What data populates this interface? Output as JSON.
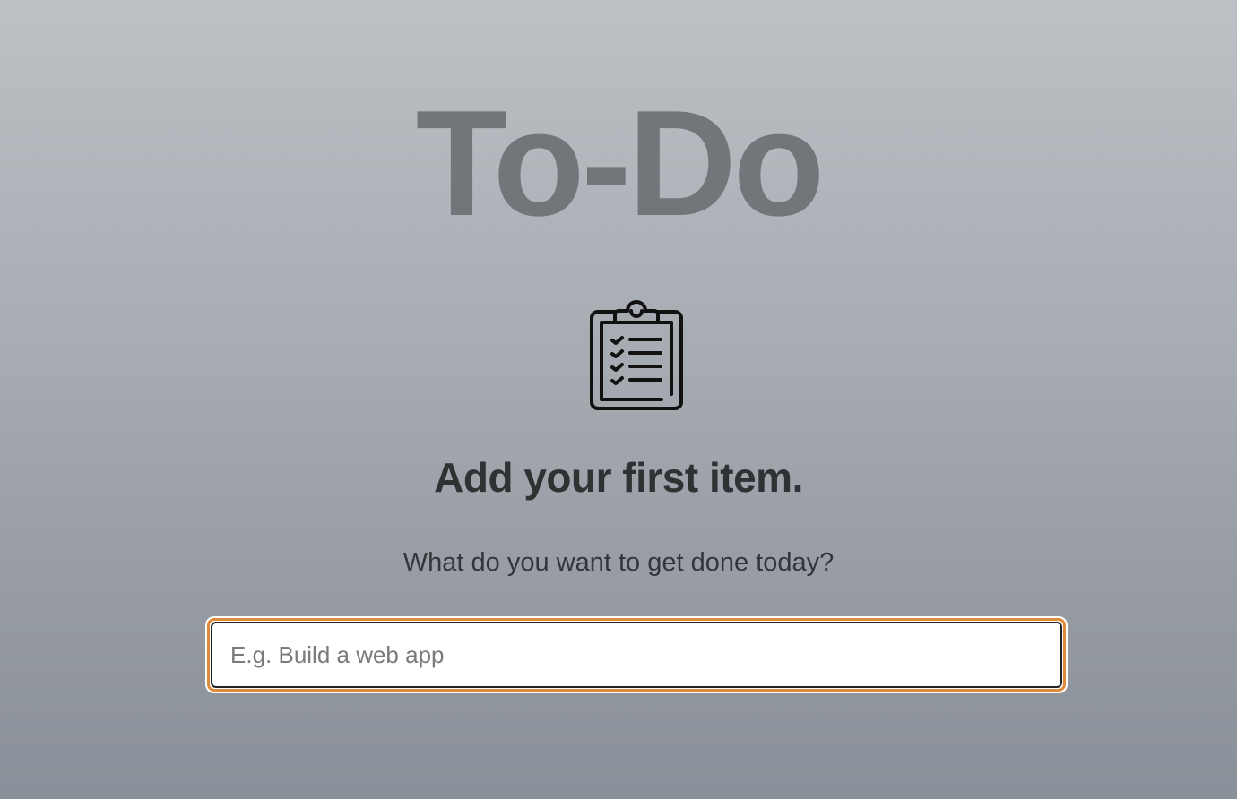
{
  "app": {
    "title": "To-Do"
  },
  "empty_state": {
    "icon": "clipboard-checklist-icon",
    "heading": "Add your first item.",
    "subtitle": "What do you want to get done today?"
  },
  "new_item": {
    "placeholder": "E.g. Build a web app",
    "value": ""
  },
  "colors": {
    "title": "#72767a",
    "heading": "#2f3133",
    "focus_ring": "#e08a3c",
    "background_top": "#bdc1c5",
    "background_bottom": "#8a9099"
  }
}
